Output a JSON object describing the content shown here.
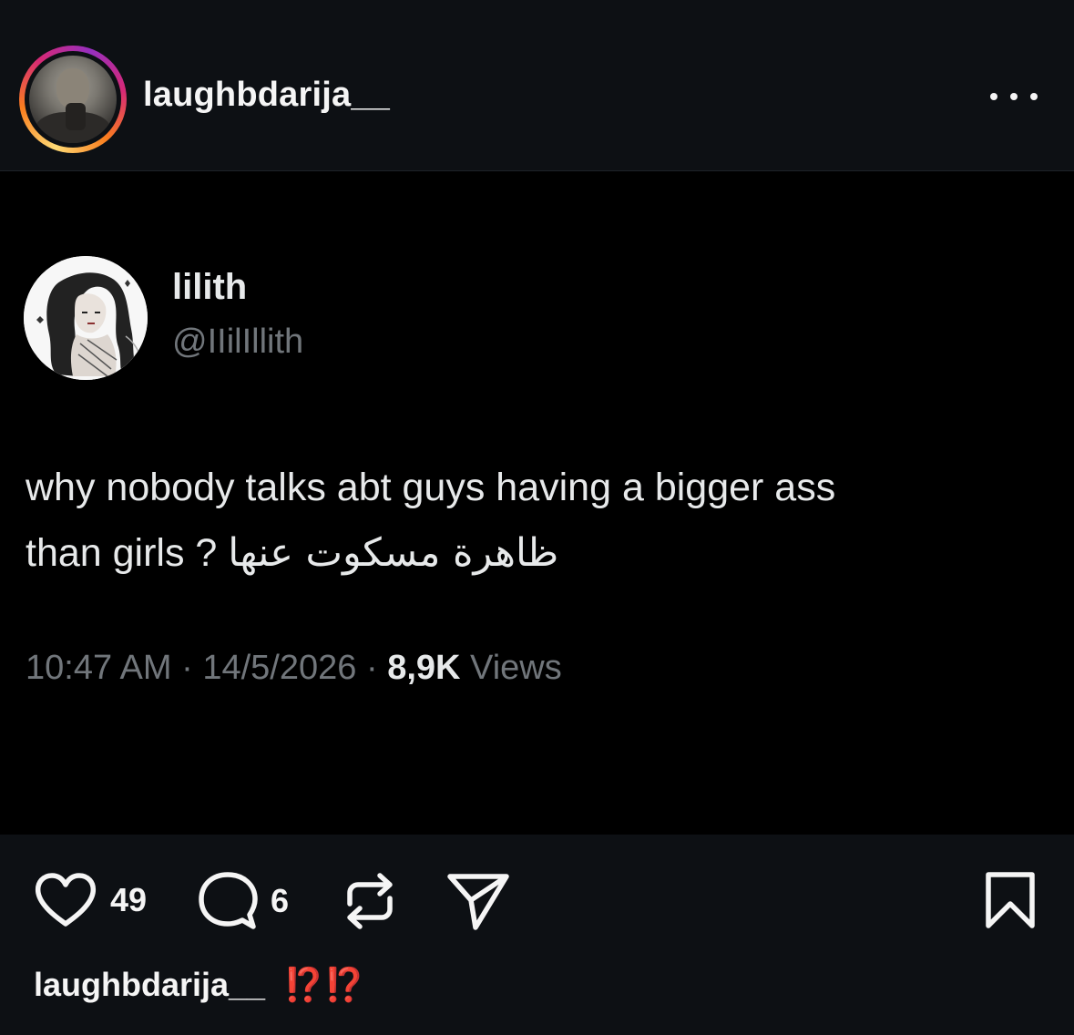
{
  "header": {
    "username": "laughbdarija__",
    "more_icon": "more-horizontal-icon"
  },
  "tweet": {
    "display_name": "lilith",
    "handle": "@IIilIllith",
    "text_line1": "why nobody talks abt guys having a bigger ass",
    "text_line2_latin": "than girls ?",
    "text_line2_arabic": "ظاهرة مسكوت عنها",
    "time": "10:47 AM",
    "separator": "·",
    "date": "14/5/2026",
    "views_count": "8,9K",
    "views_label": "Views"
  },
  "actions": {
    "like_icon": "heart-icon",
    "like_count": "49",
    "comment_icon": "comment-icon",
    "comment_count": "6",
    "repost_icon": "repost-icon",
    "share_icon": "send-icon",
    "save_icon": "bookmark-icon"
  },
  "caption": {
    "username": "laughbdarija__",
    "text": "⁉️⁉️"
  },
  "colors": {
    "background": "#0d1014",
    "tweet_background": "#000000",
    "text_primary": "#e7e9ea",
    "text_secondary": "#71767b",
    "caption_emoji": "#e0281f"
  }
}
